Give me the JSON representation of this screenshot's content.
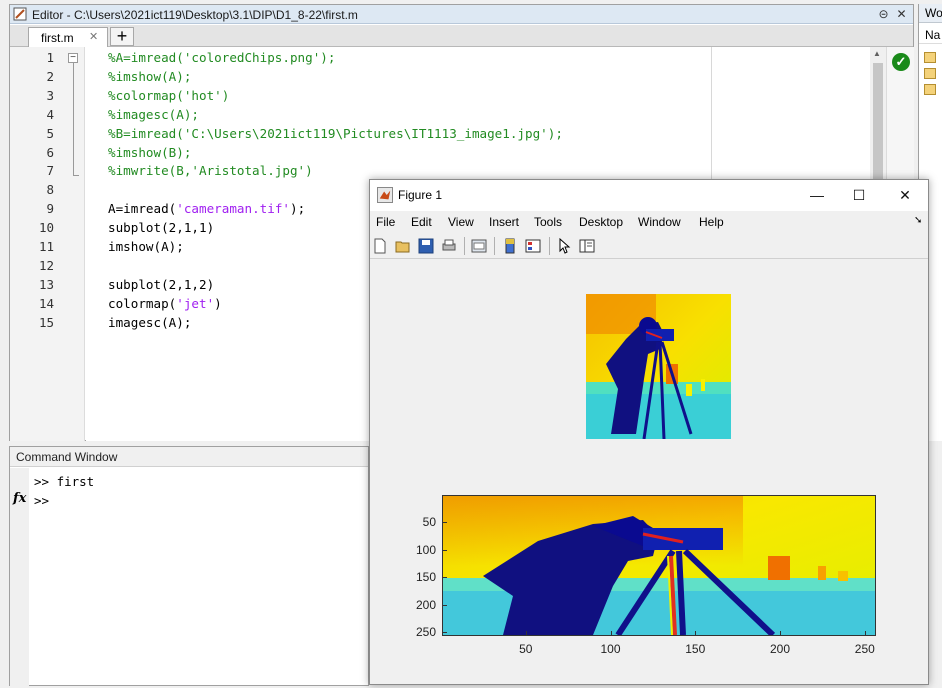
{
  "editor": {
    "title": "Editor - C:\\Users\\2021ict119\\Desktop\\3.1\\DIP\\D1_8-22\\first.m",
    "tab_label": "first.m",
    "tab_add": "+",
    "lines": [
      {
        "n": "1",
        "text": "%A=imread('coloredChips.png');",
        "type": "comment"
      },
      {
        "n": "2",
        "text": "%imshow(A);",
        "type": "comment"
      },
      {
        "n": "3",
        "text": "%colormap('hot')",
        "type": "comment"
      },
      {
        "n": "4",
        "text": "%imagesc(A);",
        "type": "comment"
      },
      {
        "n": "5",
        "text": "%B=imread('C:\\Users\\2021ict119\\Pictures\\IT1113_image1.jpg');",
        "type": "comment"
      },
      {
        "n": "6",
        "text": "%imshow(B);",
        "type": "comment"
      },
      {
        "n": "7",
        "text": "%imwrite(B,'Aristotal.jpg')",
        "type": "comment"
      },
      {
        "n": "8",
        "text": "",
        "type": "code"
      },
      {
        "n": "9",
        "pre": "A=imread(",
        "str": "'cameraman.tif'",
        "post": ");",
        "type": "mixed"
      },
      {
        "n": "10",
        "text": "subplot(2,1,1)",
        "type": "code"
      },
      {
        "n": "11",
        "text": "imshow(A);",
        "type": "code"
      },
      {
        "n": "12",
        "text": "",
        "type": "code"
      },
      {
        "n": "13",
        "text": "subplot(2,1,2)",
        "type": "code"
      },
      {
        "n": "14",
        "pre": "colormap(",
        "str": "'jet'",
        "post": ")",
        "type": "mixed"
      },
      {
        "n": "15",
        "text": "imagesc(A);",
        "type": "code"
      }
    ]
  },
  "workspace": {
    "title": "Wo",
    "name_header": "Na"
  },
  "command_window": {
    "title": "Command Window",
    "line1": ">> first",
    "prompt": ">>",
    "fx_label": "fx"
  },
  "figure": {
    "title": "Figure 1",
    "controls": {
      "minimize": "—",
      "maximize": "☐",
      "close": "✕"
    },
    "menus": [
      "File",
      "Edit",
      "View",
      "Insert",
      "Tools",
      "Desktop",
      "Window",
      "Help"
    ],
    "toolbar_icons": [
      "new-figure-icon",
      "open-file-icon",
      "save-icon",
      "print-icon",
      "link-plot-icon",
      "colorbar-icon",
      "legend-icon",
      "pointer-icon",
      "plot-browser-icon"
    ],
    "subplot_bottom": {
      "x_ticks": [
        "50",
        "100",
        "150",
        "200",
        "250"
      ],
      "y_ticks": [
        "50",
        "100",
        "150",
        "200",
        "250"
      ]
    }
  },
  "colors": {
    "comment": "#228b22",
    "string": "#a020f0",
    "jet_low": "#0000a0",
    "jet_mid": "#40e0d0",
    "jet_high": "#f8d000"
  }
}
